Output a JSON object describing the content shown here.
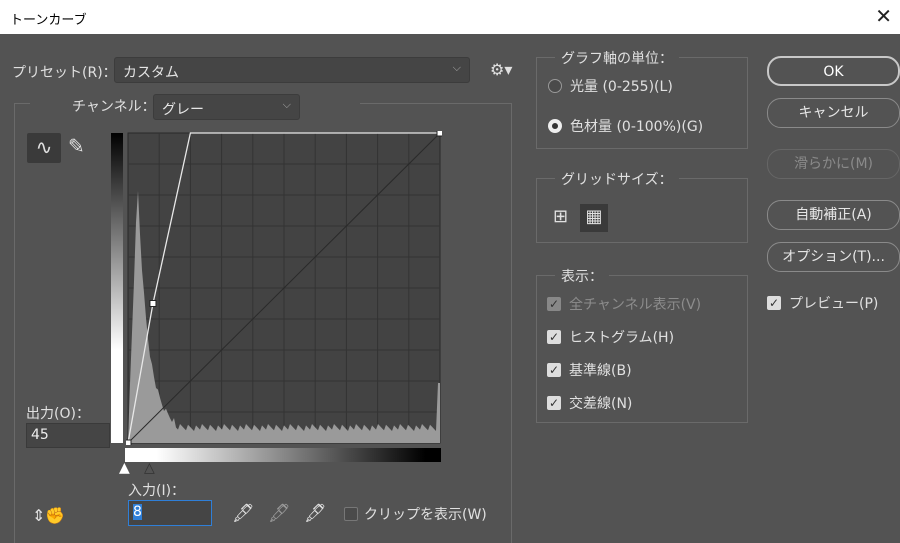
{
  "window": {
    "title": "トーンカーブ"
  },
  "preset": {
    "label": "プリセット(R)：",
    "value": "カスタム"
  },
  "channel": {
    "label": "チャンネル：",
    "value": "グレー"
  },
  "output": {
    "label": "出力(O)：",
    "value": "45"
  },
  "input": {
    "label": "入力(I)：",
    "value": "8"
  },
  "clip": {
    "label": "クリップを表示(W)",
    "checked": false
  },
  "axis_unit": {
    "title": "グラフ軸の単位：",
    "options": [
      {
        "label": "光量 (0-255)(L)",
        "selected": false
      },
      {
        "label": "色材量 (0-100%)(G)",
        "selected": true
      }
    ]
  },
  "grid_size": {
    "title": "グリッドサイズ：",
    "selected": "fine"
  },
  "display": {
    "title": "表示：",
    "options": [
      {
        "label": "全チャンネル表示(V)",
        "checked": true,
        "disabled": true
      },
      {
        "label": "ヒストグラム(H)",
        "checked": true
      },
      {
        "label": "基準線(B)",
        "checked": true
      },
      {
        "label": "交差線(N)",
        "checked": true
      }
    ]
  },
  "buttons": {
    "ok": "OK",
    "cancel": "キャンセル",
    "smooth": "滑らかに(M)",
    "auto": "自動補正(A)",
    "options": "オプション(T)..."
  },
  "preview": {
    "label": "プレビュー(P)",
    "checked": true
  },
  "curve": {
    "points": [
      [
        0,
        0
      ],
      [
        8,
        45
      ],
      [
        20,
        100
      ],
      [
        100,
        100
      ]
    ],
    "scale": "0-100%"
  },
  "colors": {
    "background": "#535353",
    "graph": "#434343",
    "curve": "#e8e8e8",
    "focus": "#2f7fd8"
  }
}
